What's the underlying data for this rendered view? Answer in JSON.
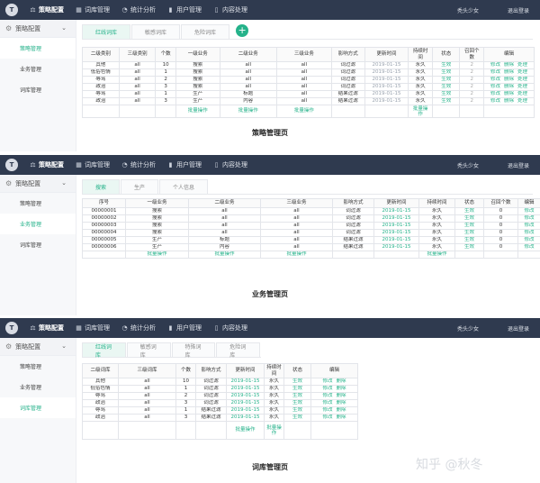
{
  "nav": {
    "logo": "T",
    "items": [
      {
        "icon": "⚖",
        "label": "策略配置"
      },
      {
        "icon": "▦",
        "label": "词库管理"
      },
      {
        "icon": "◔",
        "label": "统计分析"
      },
      {
        "icon": "▮",
        "label": "用户管理"
      },
      {
        "icon": "▯",
        "label": "内容处理"
      }
    ],
    "user": "秃头少女",
    "logout": "退出登录"
  },
  "sidebar": {
    "header": "策略配置",
    "items": [
      "策略管理",
      "业务管理",
      "词库管理"
    ]
  },
  "panel1": {
    "tabs": [
      "红线词库",
      "敏感词库",
      "危险词库"
    ],
    "add": "+",
    "headers": [
      "二级类别",
      "三级类别",
      "个数",
      "一级业务",
      "二级业务",
      "三级业务",
      "影响方式",
      "更新时间",
      "持续时间",
      "状态",
      "召回个数",
      "编辑"
    ],
    "rows": [
      [
        "其他",
        "all",
        "10",
        "搜索",
        "all",
        "all",
        "词过滤",
        "2019-01-15",
        "永久",
        "生效",
        "2"
      ],
      [
        "低俗色情",
        "all",
        "1",
        "搜索",
        "all",
        "all",
        "词过滤",
        "2019-01-15",
        "永久",
        "生效",
        "2"
      ],
      [
        "辱骂",
        "all",
        "2",
        "搜索",
        "all",
        "all",
        "词过滤",
        "2019-01-15",
        "永久",
        "生效",
        "2"
      ],
      [
        "政治",
        "all",
        "3",
        "搜索",
        "all",
        "all",
        "词过滤",
        "2019-01-15",
        "永久",
        "生效",
        "2"
      ],
      [
        "辱骂",
        "all",
        "1",
        "生产",
        "标题",
        "all",
        "结果过滤",
        "2019-01-15",
        "永久",
        "生效",
        "2"
      ],
      [
        "政治",
        "all",
        "3",
        "生产",
        "内容",
        "all",
        "结果过滤",
        "2019-01-15",
        "永久",
        "生效",
        "2"
      ]
    ],
    "actions": [
      "修改",
      "删除",
      "处理"
    ],
    "batch": "批量操作",
    "caption": "策略管理页"
  },
  "panel2": {
    "tabs": [
      "搜索",
      "生产",
      "个人信息"
    ],
    "headers": [
      "序号",
      "一级业务",
      "二级业务",
      "三级业务",
      "影响方式",
      "更新时间",
      "持续时间",
      "状态",
      "召回个数",
      "编辑"
    ],
    "rows": [
      [
        "00000001",
        "搜索",
        "all",
        "all",
        "词过滤",
        "2019-01-15",
        "永久",
        "生效",
        "0"
      ],
      [
        "00000002",
        "搜索",
        "all",
        "all",
        "词过滤",
        "2019-01-15",
        "永久",
        "生效",
        "0"
      ],
      [
        "00000003",
        "搜索",
        "all",
        "all",
        "词过滤",
        "2019-01-15",
        "永久",
        "生效",
        "0"
      ],
      [
        "00000004",
        "搜索",
        "all",
        "all",
        "词过滤",
        "2019-01-15",
        "永久",
        "生效",
        "0"
      ],
      [
        "00000005",
        "生产",
        "标题",
        "all",
        "结果过滤",
        "2019-01-15",
        "永久",
        "生效",
        "0"
      ],
      [
        "00000006",
        "生产",
        "内容",
        "all",
        "结果过滤",
        "2019-01-15",
        "永久",
        "生效",
        "0"
      ]
    ],
    "action": "修改",
    "batch": "批量操作",
    "caption": "业务管理页"
  },
  "panel3": {
    "tabs": [
      "红线词库",
      "敏感词库",
      "特殊词库",
      "危险词库"
    ],
    "headers": [
      "二级词库",
      "三级词库",
      "个数",
      "影响方式",
      "更新时间",
      "持续时间",
      "状态",
      "编辑"
    ],
    "rows": [
      [
        "其他",
        "all",
        "10",
        "词过滤",
        "2019-01-15",
        "永久",
        "生效"
      ],
      [
        "低俗色情",
        "all",
        "1",
        "词过滤",
        "2019-01-15",
        "永久",
        "生效"
      ],
      [
        "辱骂",
        "all",
        "2",
        "词过滤",
        "2019-01-15",
        "永久",
        "生效"
      ],
      [
        "政治",
        "all",
        "3",
        "词过滤",
        "2019-01-15",
        "永久",
        "生效"
      ],
      [
        "辱骂",
        "all",
        "1",
        "结果过滤",
        "2019-01-15",
        "永久",
        "生效"
      ],
      [
        "政治",
        "all",
        "3",
        "结果过滤",
        "2019-01-15",
        "永久",
        "生效"
      ]
    ],
    "actions": [
      "修改",
      "删除"
    ],
    "batch": "批量操作",
    "caption": "词库管理页"
  },
  "watermark": "知乎 @秋冬"
}
